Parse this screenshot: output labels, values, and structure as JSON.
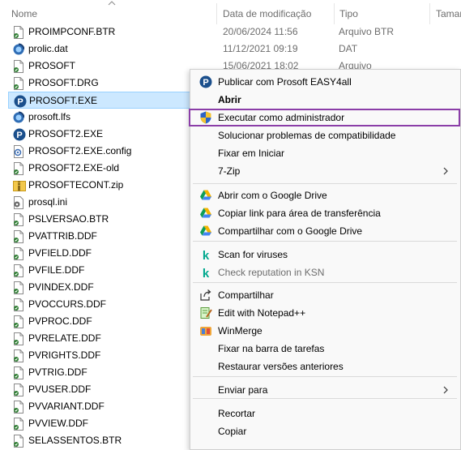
{
  "columns": {
    "name": "Nome",
    "date": "Data de modificação",
    "type": "Tipo",
    "size": "Tamar"
  },
  "files": [
    {
      "name": "PROIMPCONF.BTR",
      "date": "20/06/2024 11:56",
      "type": "Arquivo BTR",
      "icon": "document-icon"
    },
    {
      "name": "prolic.dat",
      "date": "11/12/2021 09:19",
      "type": "DAT",
      "icon": "prosoft-file-icon"
    },
    {
      "name": "PROSOFT",
      "date": "15/06/2021 18:02",
      "type": "Arquivo",
      "icon": "document-icon"
    },
    {
      "name": "PROSOFT.DRG",
      "date": "",
      "type": "",
      "icon": "document-icon"
    },
    {
      "name": "PROSOFT.EXE",
      "date": "",
      "type": "",
      "icon": "prosoft-app-icon"
    },
    {
      "name": "prosoft.lfs",
      "date": "",
      "type": "",
      "icon": "prosoft-file-icon"
    },
    {
      "name": "PROSOFT2.EXE",
      "date": "",
      "type": "",
      "icon": "prosoft-app-icon"
    },
    {
      "name": "PROSOFT2.EXE.config",
      "date": "",
      "type": "",
      "icon": "config-file-icon"
    },
    {
      "name": "PROSOFT2.EXE-old",
      "date": "",
      "type": "",
      "icon": "document-icon"
    },
    {
      "name": "PROSOFTECONT.zip",
      "date": "",
      "type": "",
      "icon": "zip-folder-icon"
    },
    {
      "name": "prosql.ini",
      "date": "",
      "type": "",
      "icon": "ini-file-icon"
    },
    {
      "name": "PSLVERSAO.BTR",
      "date": "",
      "type": "",
      "icon": "document-icon"
    },
    {
      "name": "PVATTRIB.DDF",
      "date": "",
      "type": "",
      "icon": "document-icon"
    },
    {
      "name": "PVFIELD.DDF",
      "date": "",
      "type": "",
      "icon": "document-icon"
    },
    {
      "name": "PVFILE.DDF",
      "date": "",
      "type": "",
      "icon": "document-icon"
    },
    {
      "name": "PVINDEX.DDF",
      "date": "",
      "type": "",
      "icon": "document-icon"
    },
    {
      "name": "PVOCCURS.DDF",
      "date": "",
      "type": "",
      "icon": "document-icon"
    },
    {
      "name": "PVPROC.DDF",
      "date": "",
      "type": "",
      "icon": "document-icon"
    },
    {
      "name": "PVRELATE.DDF",
      "date": "",
      "type": "",
      "icon": "document-icon"
    },
    {
      "name": "PVRIGHTS.DDF",
      "date": "",
      "type": "",
      "icon": "document-icon"
    },
    {
      "name": "PVTRIG.DDF",
      "date": "",
      "type": "",
      "icon": "document-icon"
    },
    {
      "name": "PVUSER.DDF",
      "date": "",
      "type": "",
      "icon": "document-icon"
    },
    {
      "name": "PVVARIANT.DDF",
      "date": "",
      "type": "",
      "icon": "document-icon"
    },
    {
      "name": "PVVIEW.DDF",
      "date": "",
      "type": "",
      "icon": "document-icon"
    },
    {
      "name": "SELASSENTOS.BTR",
      "date": "",
      "type": "",
      "icon": "document-icon"
    }
  ],
  "selected_file": "PROSOFT.EXE",
  "menu": {
    "items": [
      {
        "label": "Publicar com Prosoft EASY4all",
        "icon": "prosoft-app-icon"
      },
      {
        "label": "Abrir",
        "bold": true
      },
      {
        "label": "Executar como administrador",
        "icon": "uac-shield-icon",
        "highlighted": true
      },
      {
        "label": "Solucionar problemas de compatibilidade"
      },
      {
        "label": "Fixar em Iniciar"
      },
      {
        "label": "7-Zip",
        "submenu": true
      },
      {
        "label": "Abrir com o Google Drive",
        "icon": "google-drive-icon"
      },
      {
        "label": "Copiar link para área de transferência",
        "icon": "google-drive-icon"
      },
      {
        "label": "Compartilhar com o Google Drive",
        "icon": "google-drive-icon"
      },
      {
        "label": "Scan for viruses",
        "icon": "kaspersky-icon"
      },
      {
        "label": "Check reputation in KSN",
        "icon": "kaspersky-icon",
        "disabled": true
      },
      {
        "label": "Compartilhar",
        "icon": "share-icon"
      },
      {
        "label": "Edit with Notepad++",
        "icon": "notepadpp-icon"
      },
      {
        "label": "WinMerge",
        "icon": "winmerge-icon"
      },
      {
        "label": "Fixar na barra de tarefas"
      },
      {
        "label": "Restaurar versões anteriores"
      },
      {
        "label": "Enviar para",
        "submenu": true
      },
      {
        "label": "Recortar"
      },
      {
        "label": "Copiar"
      }
    ]
  },
  "colors": {
    "selection": "#cce8ff",
    "highlight_border": "#8b3ea8",
    "menu_bg": "#f9f9f9"
  }
}
